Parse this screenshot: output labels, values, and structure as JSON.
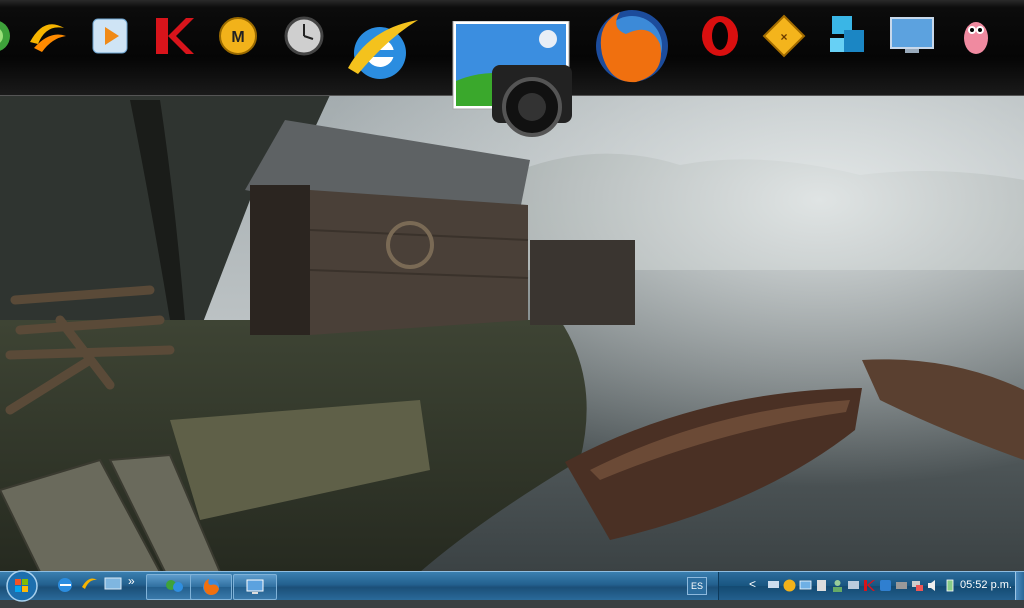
{
  "dock": {
    "items": [
      {
        "name": "messenger-icon"
      },
      {
        "name": "aim-style-icon"
      },
      {
        "name": "media-player-icon"
      },
      {
        "name": "kaspersky-icon"
      },
      {
        "name": "mediafire-icon"
      },
      {
        "name": "clock-icon"
      },
      {
        "name": "internet-explorer-icon"
      },
      {
        "name": "screenshot-camera-icon"
      },
      {
        "name": "firefox-icon"
      },
      {
        "name": "opera-icon"
      },
      {
        "name": "psp-icon"
      },
      {
        "name": "blocks-app-icon"
      },
      {
        "name": "monitor-icon"
      },
      {
        "name": "worms-icon"
      }
    ]
  },
  "taskbar": {
    "start": {
      "name": "windows-start-orb"
    },
    "quick_launch_more": "»",
    "tray": {
      "language": "ES",
      "chevron": "<",
      "clock": "05:52 p.m."
    }
  },
  "colors": {
    "taskbar": "#23608e",
    "dock_bg": "#050505",
    "accent": "#8fbde0"
  }
}
